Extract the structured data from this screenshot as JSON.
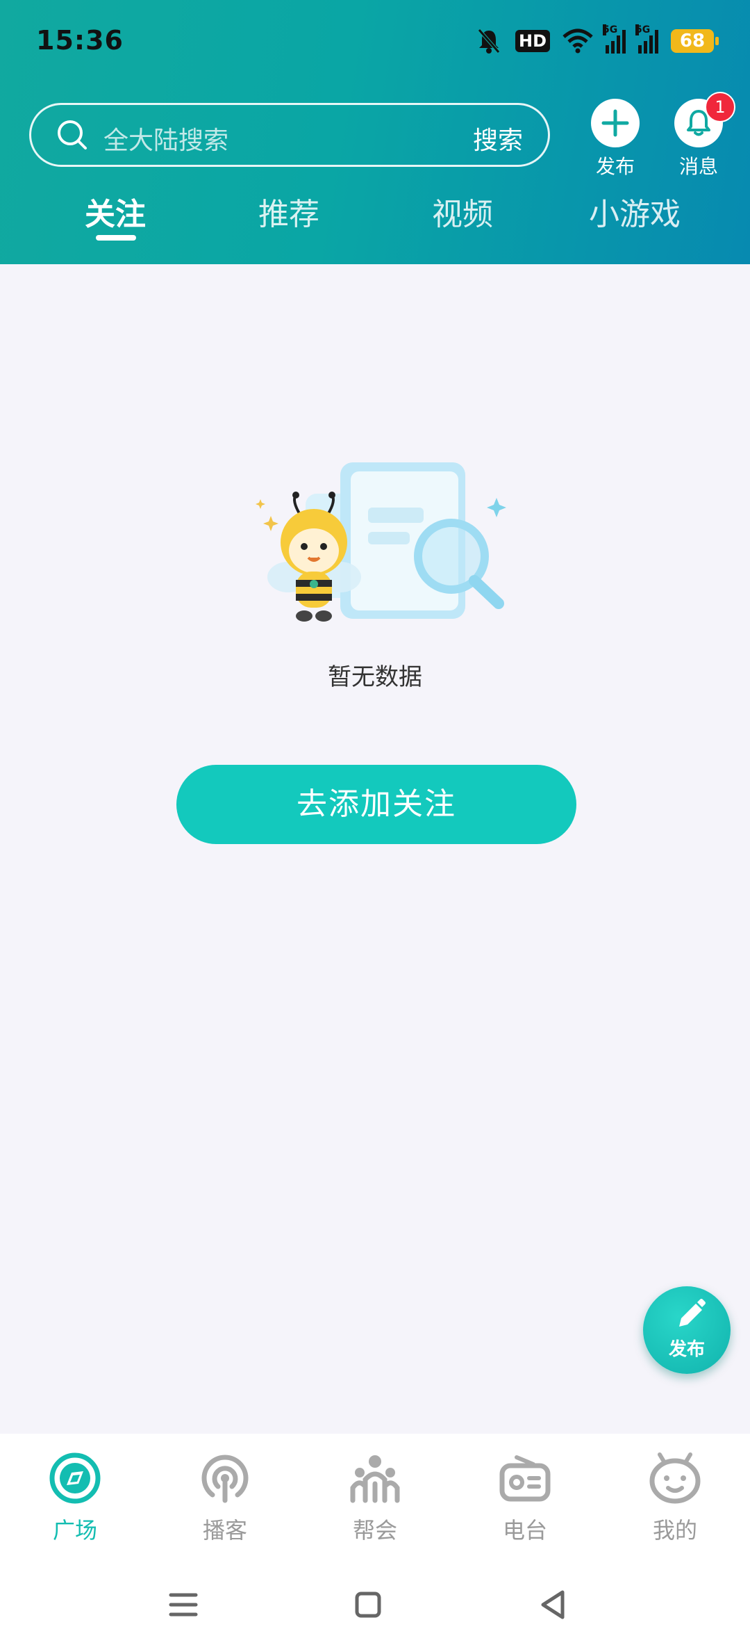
{
  "status_bar": {
    "time": "15:36",
    "hd_label": "HD",
    "signal1_label": "5G",
    "signal2_label": "5G",
    "battery": "68"
  },
  "header": {
    "search_placeholder": "全大陆搜索",
    "search_button": "搜索",
    "publish_label": "发布",
    "messages_label": "消息",
    "messages_badge": "1"
  },
  "tabs": [
    {
      "label": "关注",
      "active": true
    },
    {
      "label": "推荐",
      "active": false
    },
    {
      "label": "视频",
      "active": false
    },
    {
      "label": "小游戏",
      "active": false
    }
  ],
  "main": {
    "empty_text": "暂无数据",
    "add_follow_button": "去添加关注"
  },
  "fab": {
    "label": "发布"
  },
  "bottom_nav": [
    {
      "label": "广场",
      "icon": "compass-icon",
      "active": true
    },
    {
      "label": "播客",
      "icon": "podcast-icon",
      "active": false
    },
    {
      "label": "帮会",
      "icon": "group-icon",
      "active": false
    },
    {
      "label": "电台",
      "icon": "radio-icon",
      "active": false
    },
    {
      "label": "我的",
      "icon": "robot-face-icon",
      "active": false
    }
  ],
  "colors": {
    "accent": "#13c9bd",
    "header_gradient_start": "#11a9a0",
    "header_gradient_end": "#078ab0",
    "badge": "#f0273b",
    "background": "#f5f4fa"
  }
}
